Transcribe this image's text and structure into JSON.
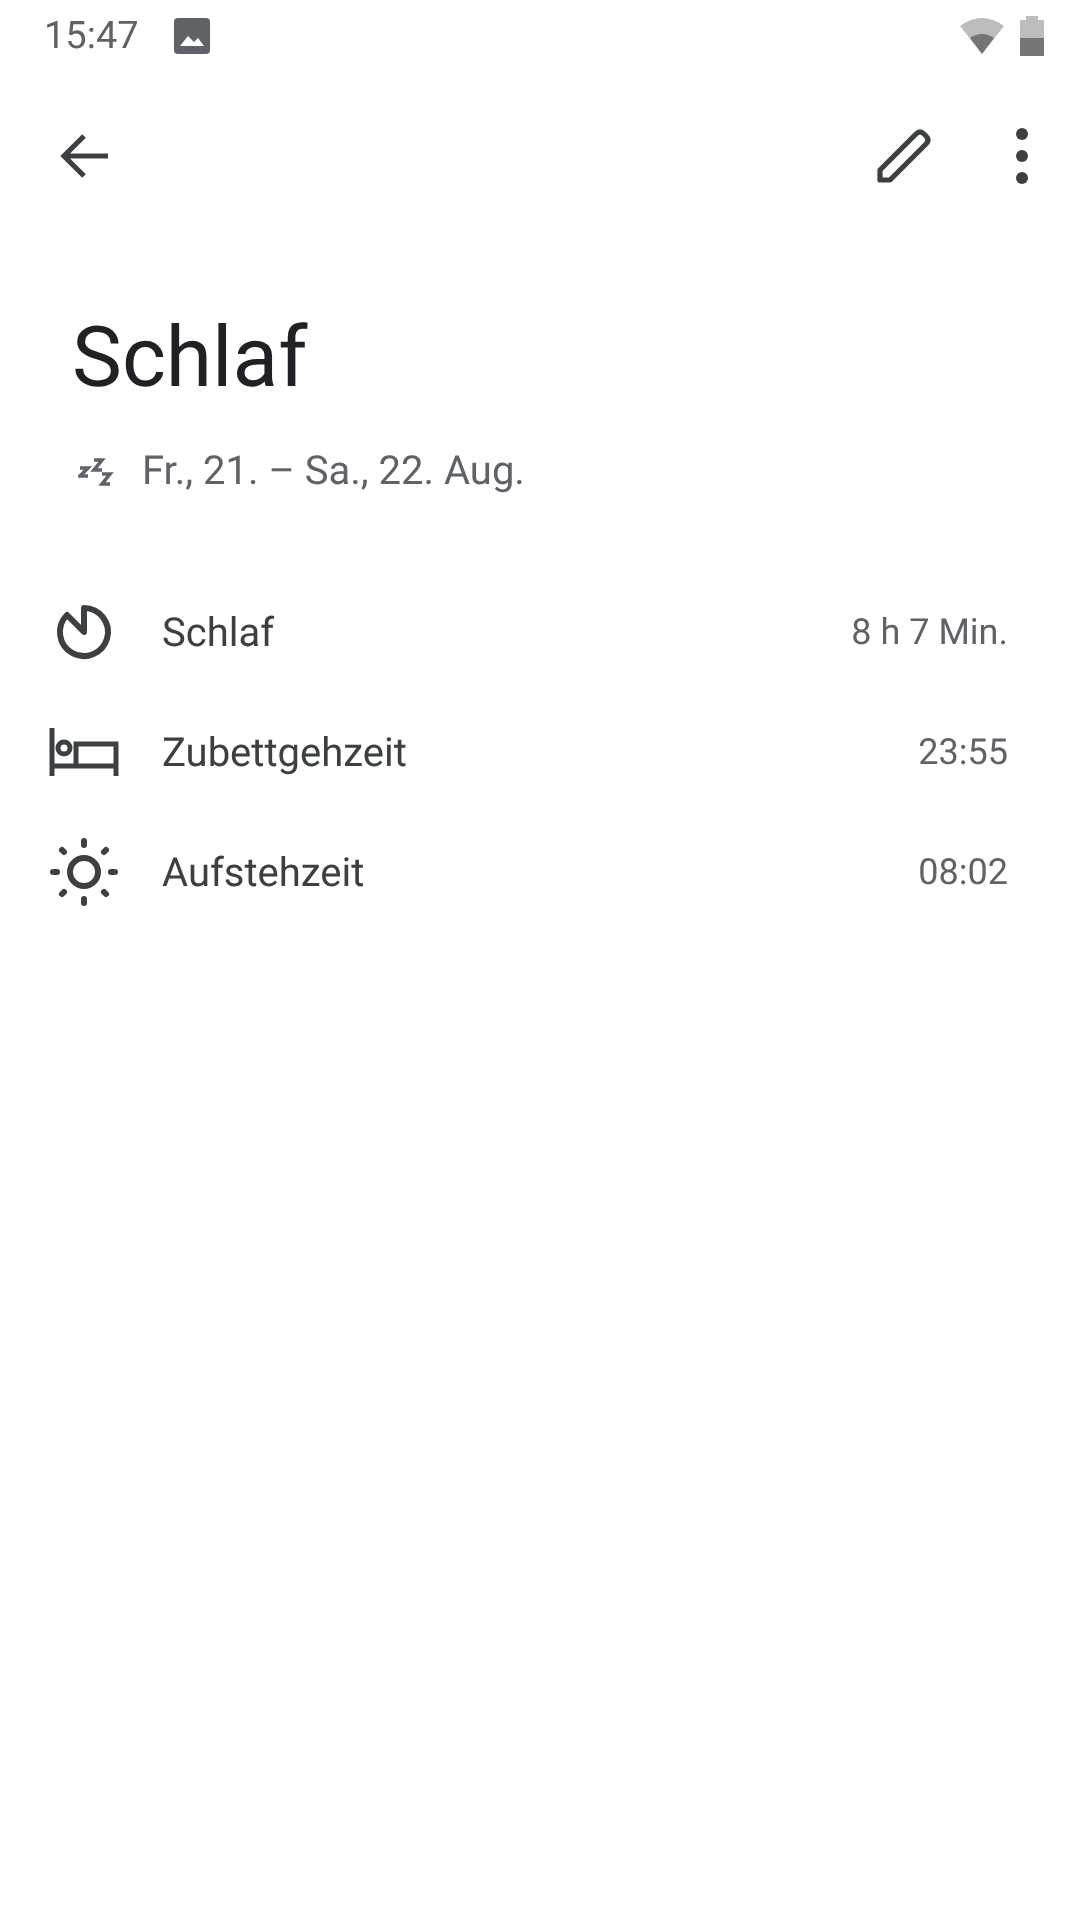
{
  "status_bar": {
    "time": "15:47"
  },
  "title": "Schlaf",
  "date_range": "Fr., 21. – Sa., 22. Aug.",
  "details": [
    {
      "kind": "timer",
      "label": "Schlaf",
      "value": "8 h 7 Min."
    },
    {
      "kind": "bed",
      "label": "Zubettgehzeit",
      "value": "23:55"
    },
    {
      "kind": "sun",
      "label": "Aufstehzeit",
      "value": "08:02"
    }
  ]
}
